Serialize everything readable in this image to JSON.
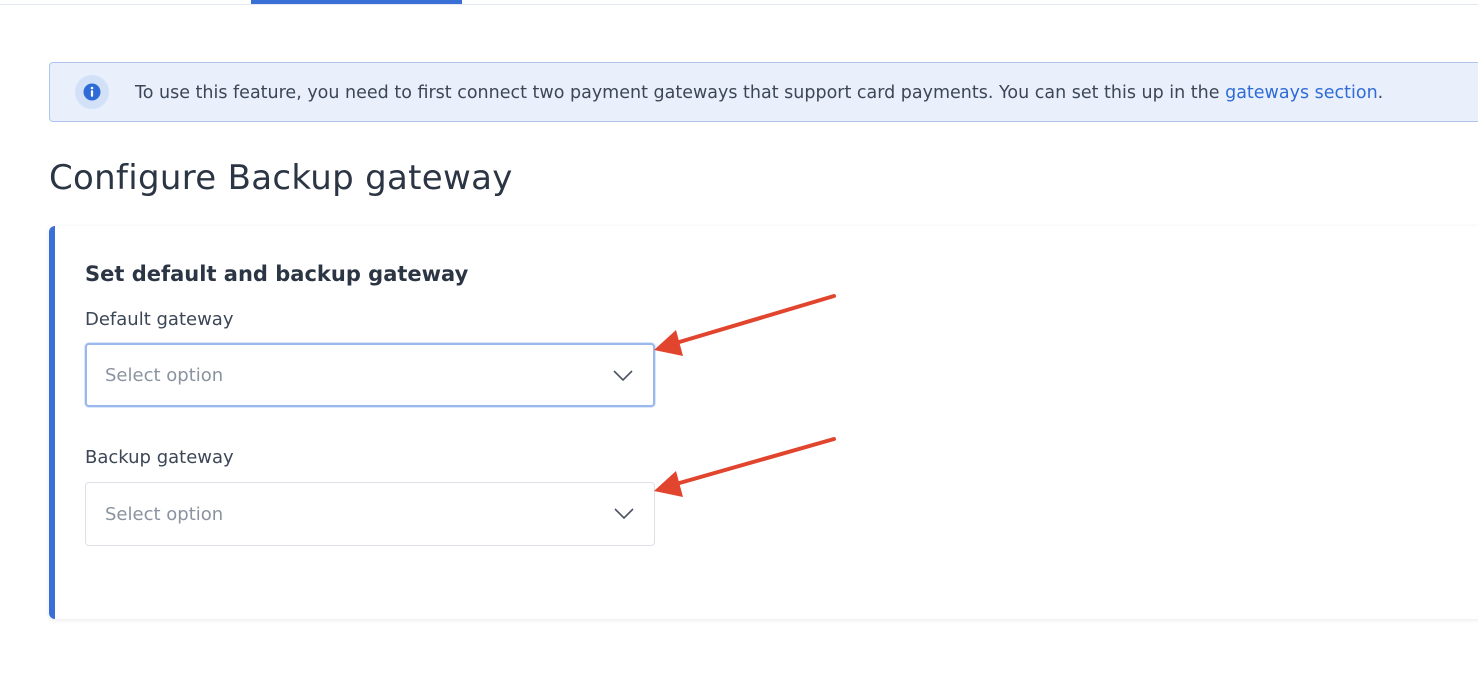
{
  "colors": {
    "accent": "#3b6fd8",
    "link": "#2f6bd6",
    "banner_bg": "#e9f0fc",
    "annotation_arrow": "#e2452e"
  },
  "banner": {
    "icon": "info-icon",
    "text": "To use this feature, you need to first connect two payment gateways that support card payments. You can set this up in the ",
    "link_text": "gateways section",
    "trailing": "."
  },
  "page": {
    "title": "Configure Backup gateway"
  },
  "card": {
    "title": "Set default and backup gateway",
    "fields": [
      {
        "label": "Default gateway",
        "placeholder": "Select option",
        "icon": "chevron-down-icon"
      },
      {
        "label": "Backup gateway",
        "placeholder": "Select option",
        "icon": "chevron-down-icon"
      }
    ]
  }
}
